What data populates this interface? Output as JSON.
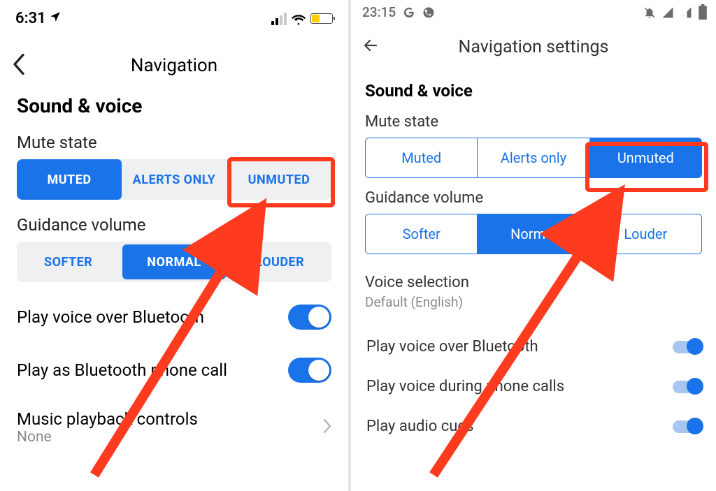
{
  "left": {
    "status": {
      "time": "6:31"
    },
    "header": {
      "title": "Navigation"
    },
    "section": "Sound & voice",
    "mute": {
      "label": "Mute state",
      "options": [
        "MUTED",
        "ALERTS ONLY",
        "UNMUTED"
      ],
      "selected": 0
    },
    "guidance": {
      "label": "Guidance volume",
      "options": [
        "SOFTER",
        "NORMAL",
        "LOUDER"
      ],
      "selected": 1
    },
    "toggles": [
      {
        "label": "Play voice over Bluetooth",
        "on": true
      },
      {
        "label": "Play as Bluetooth phone call",
        "on": true
      }
    ],
    "music": {
      "label": "Music playback controls",
      "value": "None"
    }
  },
  "right": {
    "status": {
      "time": "23:15"
    },
    "header": {
      "title": "Navigation settings"
    },
    "section": "Sound & voice",
    "mute": {
      "label": "Mute state",
      "options": [
        "Muted",
        "Alerts only",
        "Unmuted"
      ],
      "selected": 2
    },
    "guidance": {
      "label": "Guidance volume",
      "options": [
        "Softer",
        "Normal",
        "Louder"
      ],
      "selected": 1
    },
    "voice": {
      "label": "Voice selection",
      "value": "Default (English)"
    },
    "toggles": [
      {
        "label": "Play voice over Bluetooth",
        "on": true
      },
      {
        "label": "Play voice during phone calls",
        "on": true
      },
      {
        "label": "Play audio cues",
        "on": true
      }
    ]
  }
}
